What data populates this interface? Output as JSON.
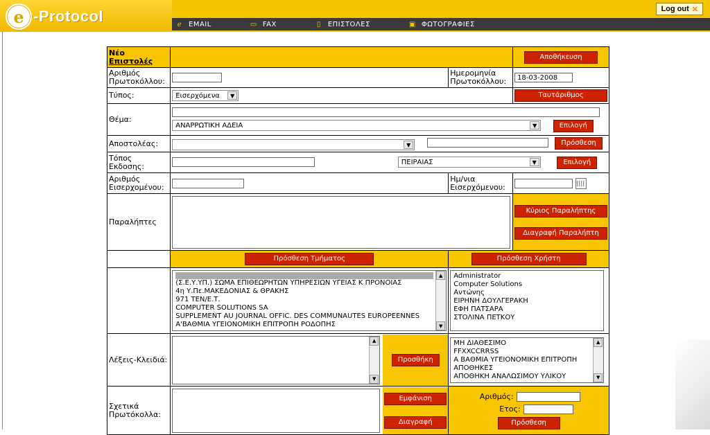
{
  "app": {
    "logo_letter": "e",
    "logo_text": "-Protocol",
    "logout": "Log out",
    "logout_x": "✕"
  },
  "nav": [
    {
      "icon": "ℯ",
      "label": "EMAIL"
    },
    {
      "icon": "▭",
      "label": "FAX"
    },
    {
      "icon": "▯",
      "label": "ΕΠΙΣΤΟΛΕΣ"
    },
    {
      "icon": "▣",
      "label": "ΦΩΤΟΓΡΑΦΙΕΣ"
    }
  ],
  "form": {
    "title1": "Νέο",
    "title2": "Επιστολές",
    "save": "Αποθήκευση",
    "protocol_number_label": "Αριθμός Πρωτοκόλλου:",
    "protocol_number_value": "",
    "protocol_date_label": "Ημερομηνία Πρωτοκόλλου:",
    "protocol_date_value": "18-03-2008",
    "type_label": "Τύπος:",
    "type_value": "Εισερχόμενα",
    "same_number": "Ταυτάριθμος",
    "subject_label": "Θέμα:",
    "subject_value": "",
    "subject_select": "ΑΝΑΡΡΩΤΙΚΗ ΑΔΕΙΑ",
    "select_btn": "Επιλογή",
    "sender_label": "Αποστολέας:",
    "sender_select": "",
    "sender_text": "",
    "add_btn": "Πρόσθεση",
    "issue_place_label": "Τόπος Εκδοσης:",
    "issue_place_value": "",
    "issue_place_select": "ΠΕΙΡΑΙΑΣ",
    "select_btn2": "Επιλογή",
    "incoming_number_label": "Αριθμός Εισερχομένου:",
    "incoming_number_value": "",
    "incoming_date_label": "Ημ/νια Εισερχόμενου:",
    "incoming_date_value": "",
    "recipients_label": "Παραλήπτες",
    "main_recipient_btn": "Κύριος Παραλήπτης",
    "delete_recipient_btn": "Διαγραφή Παραλήπτη",
    "add_department_btn": "Πρόσθεση Τμήματος",
    "add_user_btn": "Πρόσθεση Χρήστη",
    "departments": [
      "(Σ.Ε.Υ.ΥΠ.) ΣΩΜΑ ΕΠΙΘΕΩΡΗΤΩΝ ΥΠΗΡΕΣΙΩΝ ΥΓΕΙΑΣ Κ ΠΡΟΝΟΙΑΣ",
      "4η Υ.Πε.ΜΑΚΕΔΟΝΙΑΣ & ΘΡΑΚΗΣ",
      "971 ΤΕΝ/Ε.Τ.",
      "COMPUTER SOLUTIONS SA",
      "SUPPLEMENT AU JOURNAL OFFIC. DES COMMUNAUTES EUROPEENNES",
      "Α'ΒΑΘΜΙΑ ΥΓΕΙΟΝΟΜΙΚΗ ΕΠΙΤΡΟΠΗ ΡΟΔΟΠΗΣ"
    ],
    "users": [
      "Administrator",
      "Computer Solutions",
      "Αντώνης",
      "ΕΙΡΗΝΗ ΔΟΥΛΓΕΡΑΚΗ",
      "ΕΦΗ ΠΑΤΣΑΡΑ",
      "ΣΤΟΛΙΝΑ ΠΕΤΚΟΥ"
    ],
    "keywords_label": "Λέξεις-Κλειδιά:",
    "keywords_add_btn": "Προσθήκη",
    "keywords_list": [
      "ΜΗ ΔΙΑΘΕΣΙΜΟ",
      "FFXXCCRRSS",
      "Α ΒΑΘΜΙΑ ΥΓΕΙΟΝΟΜΙΚΗ ΕΠΙΤΡΟΠΗ",
      "ΑΠΟΘΗΚΕΣ",
      "ΑΠΟΘΗΚΗ ΑΝΑΛΩΣΙΜΟΥ ΥΛΙΚΟΥ"
    ],
    "related_label": "Σχετικά Πρωτόκολλα:",
    "show_btn": "Εμφάνιση",
    "delete_btn": "Διαγραφή",
    "number_label": "Αριθμός:",
    "year_label": "Ετος:",
    "related_add_btn": "Πρόσθεση"
  }
}
